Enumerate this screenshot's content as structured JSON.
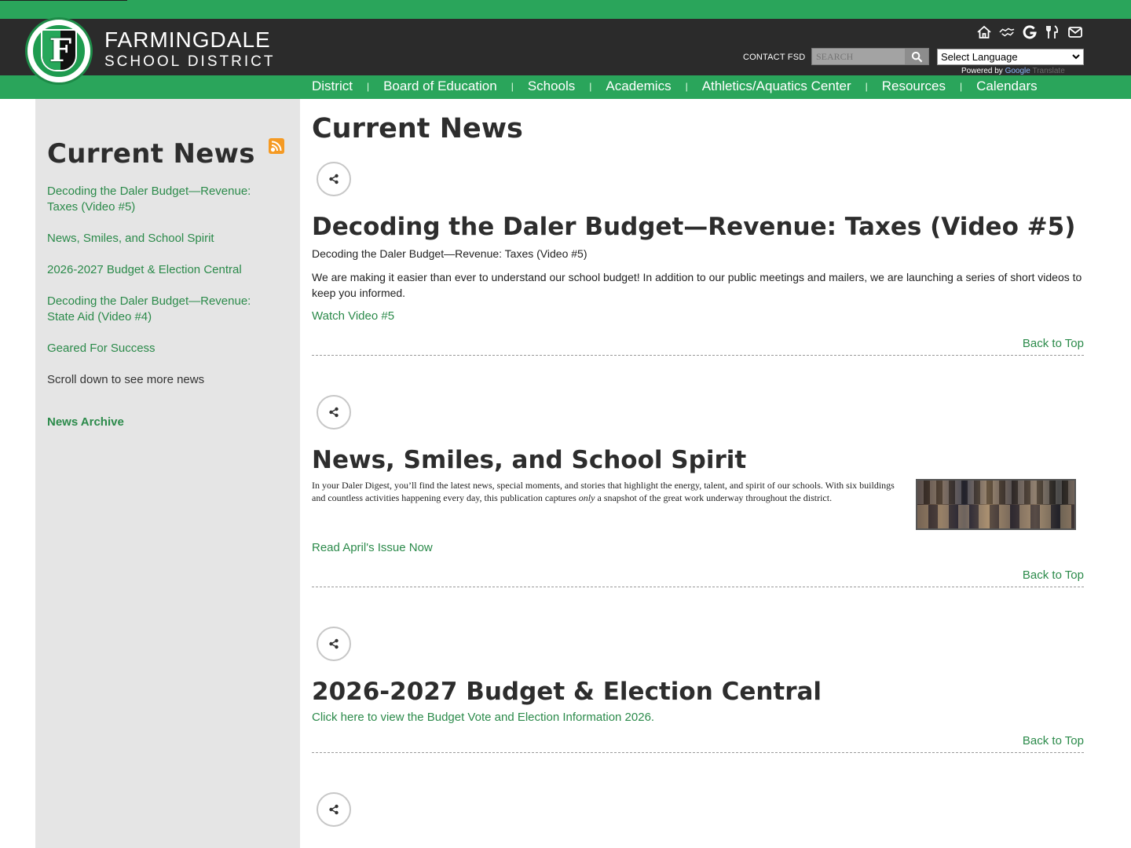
{
  "brand": {
    "line1": "FARMINGDALE",
    "line2": "SCHOOL DISTRICT",
    "logo_letter": "F",
    "logo_year": "EST. 1918",
    "colors": {
      "green": "#2aa55b",
      "dark": "#2b2b2b",
      "link": "#2b8a4a"
    }
  },
  "utility": {
    "icons": [
      "home-icon",
      "handshake-icon",
      "google-icon",
      "utensils-icon",
      "mail-icon"
    ],
    "contact_label": "CONTACT FSD",
    "search_placeholder": "SEARCH",
    "language_select": "Select Language",
    "powered_by": "Powered by",
    "google": "Google",
    "translate": "Translate"
  },
  "nav": {
    "items": [
      "District",
      "Board of Education",
      "Schools",
      "Academics",
      "Athletics/Aquatics Center",
      "Resources",
      "Calendars"
    ],
    "separator": "|"
  },
  "sidebar": {
    "title": "Current News",
    "items": [
      "Decoding the Daler Budget—Revenue: Taxes (Video #5)",
      "News, Smiles, and School Spirit",
      "2026-2027 Budget & Election Central",
      "Decoding the Daler Budget—Revenue: State Aid (Video #4)",
      "Geared For Success"
    ],
    "scroll_note": "Scroll down to see more news",
    "archive_label": "News Archive"
  },
  "main": {
    "title": "Current News",
    "back_to_top": "Back to Top",
    "articles": [
      {
        "title": "Decoding the Daler Budget—Revenue: Taxes (Video #5)",
        "subtitle": "Decoding the Daler Budget—Revenue: Taxes (Video #5)",
        "body": "We are making it easier than ever to understand our school budget! In addition to our public meetings and mailers, we are launching a series of short videos to keep you informed.",
        "link": "Watch Video #5"
      },
      {
        "title": "News, Smiles, and School Spirit",
        "body_before": "In your Daler Digest, you’ll find the latest news, special moments, and stories that highlight the energy, talent, and spirit of our schools. With six buildings and countless activities happening every day, this publication captures ",
        "body_emphasis": "only",
        "body_after": " a snapshot of the great work underway throughout the district.",
        "link": "Read April's Issue Now"
      },
      {
        "title": "2026-2027 Budget & Election Central",
        "link": "Click here to view the Budget Vote and Election Information 2026."
      }
    ]
  }
}
